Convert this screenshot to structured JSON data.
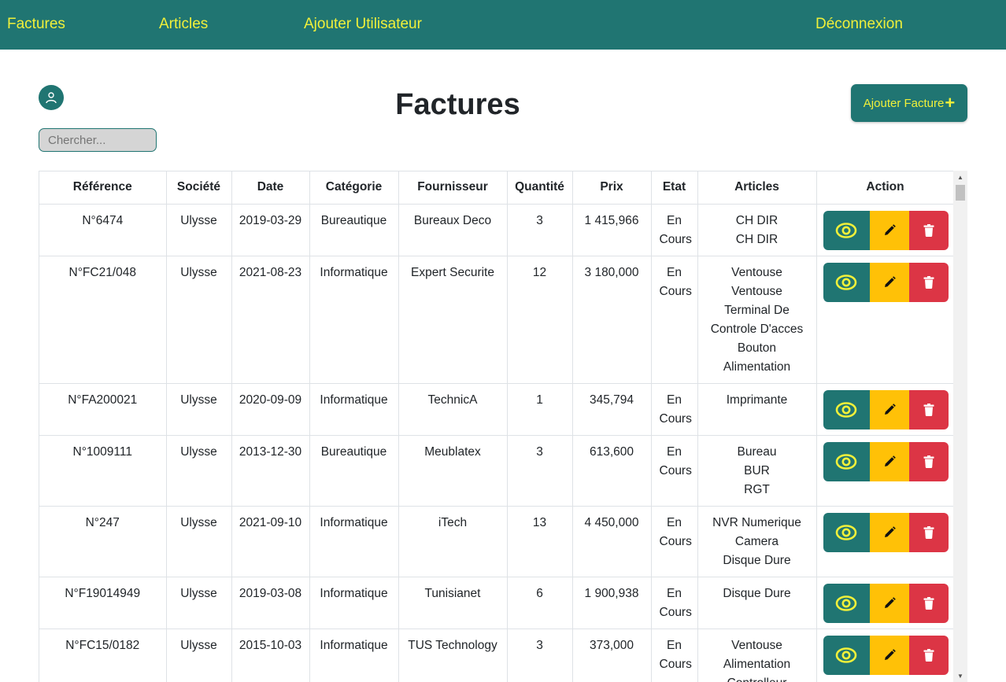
{
  "nav": {
    "factures": "Factures",
    "articles": "Articles",
    "add_user": "Ajouter Utilisateur",
    "logout": "Déconnexion"
  },
  "header": {
    "title": "Factures",
    "search_placeholder": "Chercher...",
    "add_button": "Ajouter Facture",
    "add_button_icon": "+"
  },
  "table": {
    "columns": [
      "Référence",
      "Société",
      "Date",
      "Catégorie",
      "Fournisseur",
      "Quantité",
      "Prix",
      "Etat",
      "Articles",
      "Action"
    ],
    "rows": [
      {
        "ref": "N°6474",
        "societe": "Ulysse",
        "date": "2019-03-29",
        "categorie": "Bureautique",
        "fournisseur": "Bureaux Deco",
        "quantite": "3",
        "prix": "1 415,966",
        "etat": "En Cours",
        "articles": [
          "CH DIR",
          "CH DIR"
        ]
      },
      {
        "ref": "N°FC21/048",
        "societe": "Ulysse",
        "date": "2021-08-23",
        "categorie": "Informatique",
        "fournisseur": "Expert Securite",
        "quantite": "12",
        "prix": "3 180,000",
        "etat": "En Cours",
        "articles": [
          "Ventouse",
          "Ventouse",
          "Terminal De Controle D'acces",
          "Bouton",
          "Alimentation"
        ]
      },
      {
        "ref": "N°FA200021",
        "societe": "Ulysse",
        "date": "2020-09-09",
        "categorie": "Informatique",
        "fournisseur": "TechnicA",
        "quantite": "1",
        "prix": "345,794",
        "etat": "En Cours",
        "articles": [
          "Imprimante"
        ]
      },
      {
        "ref": "N°1009111",
        "societe": "Ulysse",
        "date": "2013-12-30",
        "categorie": "Bureautique",
        "fournisseur": "Meublatex",
        "quantite": "3",
        "prix": "613,600",
        "etat": "En Cours",
        "articles": [
          "Bureau",
          "BUR",
          "RGT"
        ]
      },
      {
        "ref": "N°247",
        "societe": "Ulysse",
        "date": "2021-09-10",
        "categorie": "Informatique",
        "fournisseur": "iTech",
        "quantite": "13",
        "prix": "4 450,000",
        "etat": "En Cours",
        "articles": [
          "NVR Numerique",
          "Camera",
          "Disque Dure"
        ]
      },
      {
        "ref": "N°F19014949",
        "societe": "Ulysse",
        "date": "2019-03-08",
        "categorie": "Informatique",
        "fournisseur": "Tunisianet",
        "quantite": "6",
        "prix": "1 900,938",
        "etat": "En Cours",
        "articles": [
          "Disque Dure"
        ]
      },
      {
        "ref": "N°FC15/0182",
        "societe": "Ulysse",
        "date": "2015-10-03",
        "categorie": "Informatique",
        "fournisseur": "TUS Technology",
        "quantite": "3",
        "prix": "373,000",
        "etat": "En Cours",
        "articles": [
          "Ventouse",
          "Alimentation",
          "Controlleur"
        ]
      }
    ]
  },
  "colors": {
    "primary": "#207572",
    "nav_text": "#f0f03a",
    "edit": "#ffc107",
    "delete": "#dc3545"
  },
  "icons": {
    "view": "eye-icon",
    "edit": "pencil-icon",
    "delete": "trash-icon",
    "avatar": "user-icon"
  }
}
